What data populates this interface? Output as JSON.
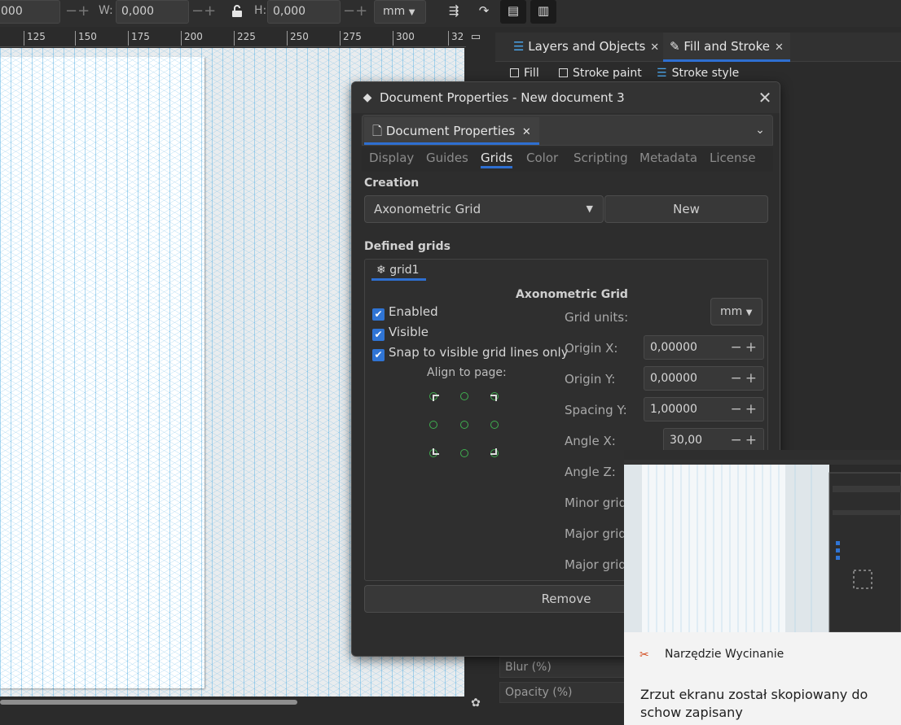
{
  "toolbar": {
    "x_value": "000",
    "w_label": "W:",
    "w_value": "0,000",
    "h_label": "H:",
    "h_value": "0,000",
    "units": "mm",
    "lock_icon": "lock-open-icon"
  },
  "ruler": {
    "ticks": [
      "125",
      "150",
      "175",
      "200",
      "225",
      "250",
      "275",
      "300",
      "32"
    ]
  },
  "right_panel": {
    "tabs": [
      {
        "label": "Layers and Objects",
        "icon": "layers-icon"
      },
      {
        "label": "Fill and Stroke",
        "icon": "fill-stroke-icon"
      }
    ],
    "fill_tabs": {
      "fill": "Fill",
      "stroke_paint": "Stroke paint",
      "stroke_style": "Stroke style"
    },
    "blur_label": "Blur (%)",
    "opacity_label": "Opacity (%)"
  },
  "dialog": {
    "title": "Document Properties - New document 3",
    "notebook_tab": "Document Properties",
    "subtabs": [
      "Display",
      "Guides",
      "Grids",
      "Color",
      "Scripting",
      "Metadata",
      "License"
    ],
    "active_subtab": "Grids",
    "creation_label": "Creation",
    "grid_type": "Axonometric Grid",
    "new_button": "New",
    "defined_grids_label": "Defined grids",
    "grid_tab": "grid1",
    "grid_title": "Axonometric Grid",
    "checks": {
      "enabled": "Enabled",
      "visible": "Visible",
      "snap": "Snap to visible grid lines only"
    },
    "align_label": "Align to page:",
    "props": {
      "grid_units_label": "Grid units:",
      "grid_units_value": "mm",
      "origin_x_label": "Origin X:",
      "origin_x_value": "0,00000",
      "origin_y_label": "Origin Y:",
      "origin_y_value": "0,00000",
      "spacing_y_label": "Spacing Y:",
      "spacing_y_value": "1,00000",
      "angle_x_label": "Angle X:",
      "angle_x_value": "30,00",
      "angle_z_label": "Angle Z:",
      "minor_grid_label": "Minor grid",
      "major_grid_label": "Major grid",
      "major_grid2_label": "Major grid"
    },
    "remove_button": "Remove"
  },
  "snip": {
    "app_name": "Narzędzie Wycinanie",
    "message": "Zrzut ekranu został skopiowany do schow zapisany"
  },
  "colors": {
    "accent": "#2e6fd1",
    "checkbox": "#2f74d4",
    "grid_line": "#69b9e6",
    "anchor": "#3fae4f"
  }
}
